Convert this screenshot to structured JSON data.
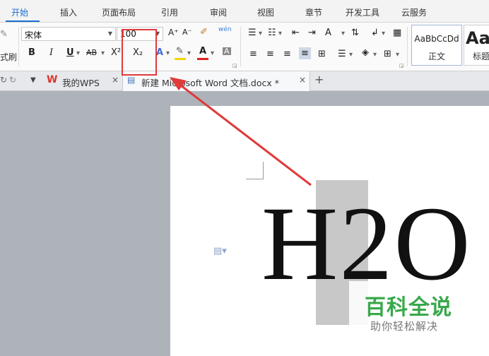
{
  "ribbon_tabs": [
    "开始",
    "插入",
    "页面布局",
    "引用",
    "审阅",
    "视图",
    "章节",
    "开发工具",
    "云服务"
  ],
  "font": {
    "name": "宋体",
    "size": "100"
  },
  "clipboard": {
    "format_painter_label": "式刷"
  },
  "tools": {
    "bold": "B",
    "italic": "I",
    "underline": "U",
    "strikethrough": "AB",
    "superscript": "X²",
    "subscript": "X₂",
    "grow_font": "A⁺",
    "shrink_font": "A⁻",
    "clear_format": "A",
    "font_color": "A",
    "char_shading": "A",
    "pinyin": "wén"
  },
  "styles": [
    {
      "sample": "AaBbCcDd",
      "name": "正文"
    },
    {
      "sample": "Aa",
      "name": "标题"
    }
  ],
  "doc_tabs": {
    "home": "我的WPS",
    "document": "新建 Microsoft Word 文档.docx *"
  },
  "document": {
    "text": "H2O"
  },
  "watermark": {
    "title": "百科全说",
    "subtitle": "助你轻松解决"
  },
  "colors": {
    "accent": "#1a6fd1",
    "annotation": "#e03a3a",
    "highlight_swatch": "#f5d400",
    "font_color_swatch": "#e02020",
    "wps_logo": "#d9382f",
    "watermark_green": "#38a84a"
  }
}
